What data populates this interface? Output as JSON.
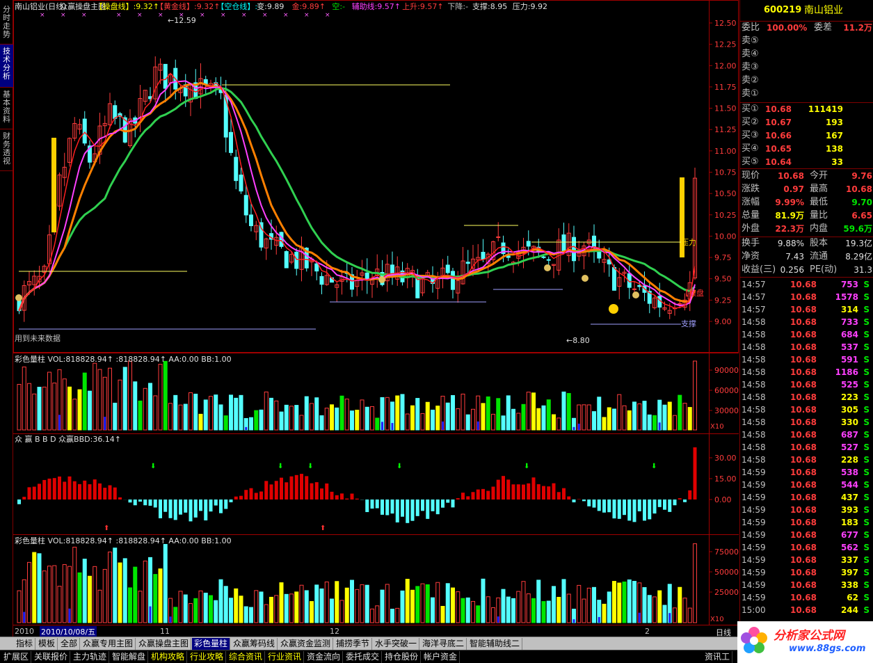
{
  "left_tabs": [
    {
      "label": "分时走势",
      "active": false
    },
    {
      "label": "技术分析",
      "active": true
    },
    {
      "label": "基本资料",
      "active": false
    },
    {
      "label": "财务透视",
      "active": false
    }
  ],
  "main_panel": {
    "header": [
      {
        "text": "南山铝业(日线)",
        "color": "#e0e0e0"
      },
      {
        "text": "众赢操盘主图",
        "color": "#e0e0e0"
      },
      {
        "text": "【操盘线】:9.32↑",
        "color": "#ffff00"
      },
      {
        "text": "【黄金线】:9.32↑",
        "color": "#ff3c3c"
      },
      {
        "text": "【空仓线】:-",
        "color": "#00ffff"
      },
      {
        "text": "变:9.89",
        "color": "#e0e0e0"
      },
      {
        "text": "金:9.89↑",
        "color": "#ff3c3c"
      },
      {
        "text": "空:-",
        "color": "#00e600"
      },
      {
        "text": "辅助线:9.57↑",
        "color": "#ff40ff"
      },
      {
        "text": "上升:9.57↑",
        "color": "#ff3c3c"
      },
      {
        "text": "下降:-",
        "color": "#c0c0c0"
      },
      {
        "text": "支撑:8.95",
        "color": "#e0e0e0"
      },
      {
        "text": "压力:9.92",
        "color": "#e0e0e0"
      }
    ],
    "price_labels": [
      "12.50",
      "12.25",
      "12.00",
      "11.75",
      "11.50",
      "11.25",
      "11.00",
      "10.75",
      "10.50",
      "10.25",
      "10.00",
      "9.75",
      "9.50",
      "9.25",
      "9.00"
    ],
    "annotations": {
      "high": "12.59",
      "low": "8.80",
      "pressure": "压力",
      "operate": "【操盘",
      "support": "支撑",
      "future_note": "用到未来数据"
    }
  },
  "chart_data": [
    {
      "type": "candlestick",
      "title": "南山铝业(日线) 众赢操盘主图",
      "ylim": [
        8.75,
        12.6
      ],
      "high_marker": 12.59,
      "low_marker": 8.8,
      "support": 8.95,
      "pressure": 9.92,
      "last_close": 10.68
    },
    {
      "type": "bar",
      "title": "彩色量柱",
      "header": "彩色量柱 VOL:818828.94↑  :818828.94↑  AA:0.00  BB:1.00",
      "ytick_labels": [
        "90000",
        "60000",
        "30000"
      ],
      "unit": "X10",
      "last_value": 818828.94
    },
    {
      "type": "bar",
      "title": "众赢BBD",
      "header": "众 赢 B B D  众赢BBD:36.14↑",
      "ytick_labels": [
        "30.00",
        "15.00",
        "0.00"
      ],
      "last_value": 36.14
    },
    {
      "type": "bar",
      "title": "彩色量柱",
      "header": "彩色量柱 VOL:818828.94↑  :818828.94↑  AA:0.00  BB:1.00",
      "ytick_labels": [
        "75000",
        "50000",
        "25000"
      ],
      "unit": "X10",
      "last_value": 818828.94
    }
  ],
  "date_axis": {
    "start": "2010",
    "selected": "2010/10/08/五",
    "ticks": [
      "11",
      "12",
      "2"
    ],
    "period": "日线"
  },
  "quote": {
    "code": "600219",
    "name": "南山铝业",
    "weibi_label": "委比",
    "weibi": "100.00%",
    "weicha_label": "委差",
    "weicha": "11.2万",
    "sell": [
      {
        "label": "卖⑤",
        "price": "",
        "vol": ""
      },
      {
        "label": "卖④",
        "price": "",
        "vol": ""
      },
      {
        "label": "卖③",
        "price": "",
        "vol": ""
      },
      {
        "label": "卖②",
        "price": "",
        "vol": ""
      },
      {
        "label": "卖①",
        "price": "",
        "vol": ""
      }
    ],
    "buy": [
      {
        "label": "买①",
        "price": "10.68",
        "vol": "111419"
      },
      {
        "label": "买②",
        "price": "10.67",
        "vol": "193"
      },
      {
        "label": "买③",
        "price": "10.66",
        "vol": "167"
      },
      {
        "label": "买④",
        "price": "10.65",
        "vol": "138"
      },
      {
        "label": "买⑤",
        "price": "10.64",
        "vol": "33"
      }
    ],
    "stats": [
      {
        "l1": "现价",
        "v1": "10.68",
        "c1": "red",
        "l2": "今开",
        "v2": "9.76",
        "c2": "red"
      },
      {
        "l1": "涨跌",
        "v1": "0.97",
        "c1": "red",
        "l2": "最高",
        "v2": "10.68",
        "c2": "red"
      },
      {
        "l1": "涨幅",
        "v1": "9.99%",
        "c1": "red",
        "l2": "最低",
        "v2": "9.70",
        "c2": "grn"
      },
      {
        "l1": "总量",
        "v1": "81.9万",
        "c1": "yel",
        "l2": "量比",
        "v2": "6.65",
        "c2": "red"
      },
      {
        "l1": "外盘",
        "v1": "22.3万",
        "c1": "red",
        "l2": "内盘",
        "v2": "59.6万",
        "c2": "grn"
      }
    ],
    "stats2": [
      {
        "l1": "换手",
        "v1": "9.88%",
        "l2": "股本",
        "v2": "19.3亿"
      },
      {
        "l1": "净资",
        "v1": "7.43",
        "l2": "流通",
        "v2": "8.29亿"
      },
      {
        "l1": "收益(三)",
        "v1": "0.256",
        "l2": "PE(动)",
        "v2": "31.3"
      }
    ],
    "ticks": [
      {
        "t": "14:57",
        "p": "10.68",
        "v": "753",
        "s": "S"
      },
      {
        "t": "14:57",
        "p": "10.68",
        "v": "1578",
        "s": "S"
      },
      {
        "t": "14:57",
        "p": "10.68",
        "v": "314",
        "s": "S"
      },
      {
        "t": "14:58",
        "p": "10.68",
        "v": "733",
        "s": "S"
      },
      {
        "t": "14:58",
        "p": "10.68",
        "v": "684",
        "s": "S"
      },
      {
        "t": "14:58",
        "p": "10.68",
        "v": "537",
        "s": "S"
      },
      {
        "t": "14:58",
        "p": "10.68",
        "v": "591",
        "s": "S"
      },
      {
        "t": "14:58",
        "p": "10.68",
        "v": "1186",
        "s": "S"
      },
      {
        "t": "14:58",
        "p": "10.68",
        "v": "525",
        "s": "S"
      },
      {
        "t": "14:58",
        "p": "10.68",
        "v": "223",
        "s": "S"
      },
      {
        "t": "14:58",
        "p": "10.68",
        "v": "305",
        "s": "S"
      },
      {
        "t": "14:58",
        "p": "10.68",
        "v": "330",
        "s": "S"
      },
      {
        "t": "14:58",
        "p": "10.68",
        "v": "687",
        "s": "S"
      },
      {
        "t": "14:58",
        "p": "10.68",
        "v": "527",
        "s": "S"
      },
      {
        "t": "14:58",
        "p": "10.68",
        "v": "228",
        "s": "S"
      },
      {
        "t": "14:59",
        "p": "10.68",
        "v": "538",
        "s": "S"
      },
      {
        "t": "14:59",
        "p": "10.68",
        "v": "544",
        "s": "S"
      },
      {
        "t": "14:59",
        "p": "10.68",
        "v": "437",
        "s": "S"
      },
      {
        "t": "14:59",
        "p": "10.68",
        "v": "393",
        "s": "S"
      },
      {
        "t": "14:59",
        "p": "10.68",
        "v": "183",
        "s": "S"
      },
      {
        "t": "14:59",
        "p": "10.68",
        "v": "677",
        "s": "S"
      },
      {
        "t": "14:59",
        "p": "10.68",
        "v": "562",
        "s": "S"
      },
      {
        "t": "14:59",
        "p": "10.68",
        "v": "337",
        "s": "S"
      },
      {
        "t": "14:59",
        "p": "10.68",
        "v": "397",
        "s": "S"
      },
      {
        "t": "14:59",
        "p": "10.68",
        "v": "338",
        "s": "S"
      },
      {
        "t": "14:59",
        "p": "10.68",
        "v": "62",
        "s": "S"
      },
      {
        "t": "15:00",
        "p": "10.68",
        "v": "244",
        "s": "S"
      }
    ]
  },
  "tabs": [
    "指标",
    "模板",
    "全部",
    "众赢专用主图",
    "众赢操盘主图",
    "彩色量柱",
    "众赢筹码线",
    "众赢资金监测",
    "捕捞季节",
    "水手突破一",
    "海洋寻底二",
    "智能辅助线二"
  ],
  "active_tab": "彩色量柱",
  "toolbar": [
    "扩展区",
    "关联报价",
    "主力轨迹",
    "智能解盘",
    "机构攻略",
    "行业攻略",
    "综合资讯",
    "行业资讯",
    "资金流向",
    "委托成交",
    "持仓股份",
    "帐户资金"
  ],
  "toolbar_right": "资讯工",
  "watermark": {
    "title": "分析家公式网",
    "url": "www.88gs.com"
  }
}
